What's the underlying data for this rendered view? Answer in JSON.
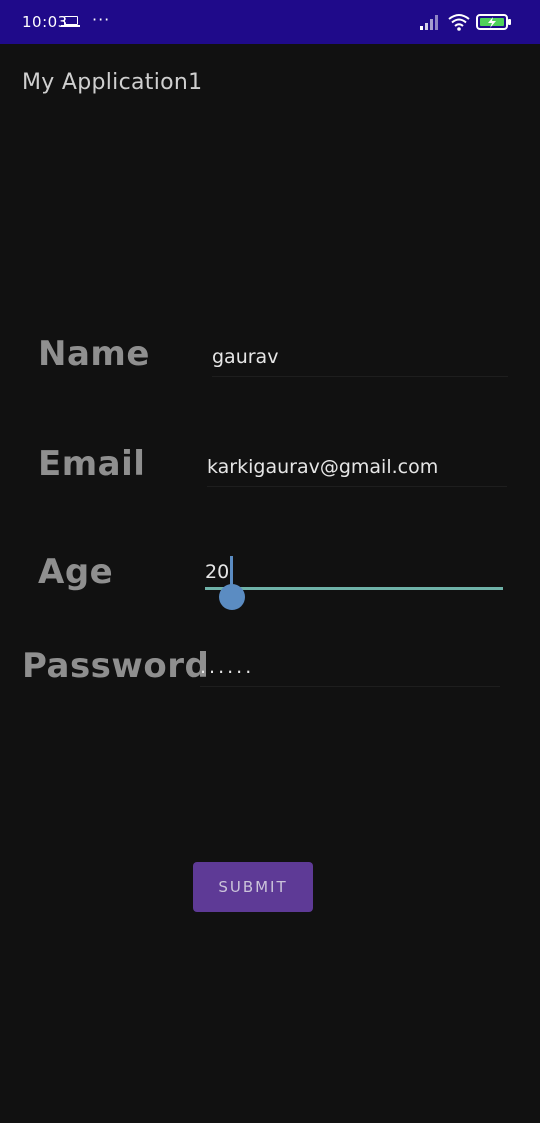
{
  "status_bar": {
    "time": "10:03",
    "more": "···",
    "background": "#1f0a8a",
    "icons": [
      "laptop-icon",
      "signal-icon",
      "wifi-icon",
      "battery-charging-icon"
    ]
  },
  "app": {
    "title": "My Application1"
  },
  "form": {
    "name": {
      "label": "Name",
      "value": "gaurav"
    },
    "email": {
      "label": "Email",
      "value": "karkigaurav@gmail.com"
    },
    "age": {
      "label": "Age",
      "value": "20"
    },
    "password": {
      "label": "Password",
      "value": "......"
    },
    "submit_label": "SUBMIT"
  },
  "colors": {
    "background": "#111111",
    "accent": "#5e3a96",
    "slider_track": "#6fb2a8",
    "slider_thumb": "#5b8cc2"
  }
}
